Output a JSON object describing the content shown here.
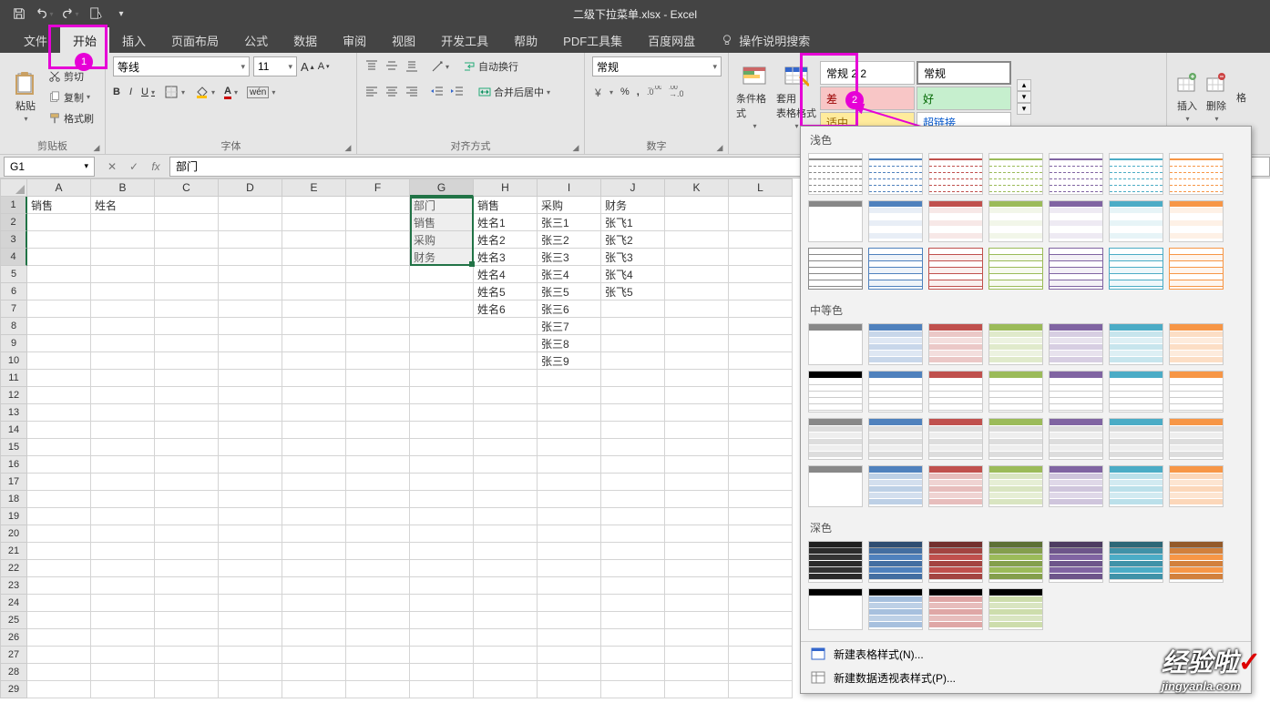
{
  "window": {
    "title": "二级下拉菜单.xlsx  -  Excel"
  },
  "qat": {
    "save": "保存",
    "undo": "撤销",
    "redo": "重做",
    "touch": "触摸"
  },
  "tabs": {
    "file": "文件",
    "home": "开始",
    "insert": "插入",
    "layout": "页面布局",
    "formulas": "公式",
    "data": "数据",
    "review": "审阅",
    "view": "视图",
    "dev": "开发工具",
    "help": "帮助",
    "pdf": "PDF工具集",
    "baidu": "百度网盘",
    "tellme": "操作说明搜索"
  },
  "steps": {
    "one": "1",
    "two": "2"
  },
  "clipboard": {
    "group": "剪贴板",
    "paste": "粘贴",
    "cut": "剪切",
    "copy": "复制",
    "painter": "格式刷"
  },
  "font": {
    "group": "字体",
    "name": "等线",
    "size": "11"
  },
  "align": {
    "group": "对齐方式",
    "wrap": "自动换行",
    "merge": "合并后居中"
  },
  "number": {
    "group": "数字",
    "format": "常规"
  },
  "styles": {
    "cond": "条件格式",
    "table": "套用\n表格格式",
    "s1": "常规 2 2",
    "s2": "常规",
    "s3": "差",
    "s4": "好",
    "s5": "适中",
    "s6": "超链接"
  },
  "cells_group": {
    "insert": "插入",
    "delete": "删除",
    "format": "格"
  },
  "fx": {
    "name_box": "G1",
    "cancel": "✕",
    "enter": "✓",
    "fx": "fx",
    "value": "部门"
  },
  "gallery": {
    "light": "浅色",
    "medium": "中等色",
    "dark": "深色",
    "new_style": "新建表格样式(N)...",
    "new_pivot": "新建数据透视表样式(P)..."
  },
  "columns": [
    "A",
    "B",
    "C",
    "D",
    "E",
    "F",
    "G",
    "H",
    "I",
    "J",
    "K",
    "L"
  ],
  "grid": {
    "rows": 29,
    "data": {
      "1": {
        "A": "销售",
        "B": "姓名",
        "G": "部门",
        "H": "销售",
        "I": "采购",
        "J": "财务"
      },
      "2": {
        "G": "销售",
        "H": "姓名1",
        "I": "张三1",
        "J": "张飞1"
      },
      "3": {
        "G": "采购",
        "H": "姓名2",
        "I": "张三2",
        "J": "张飞2"
      },
      "4": {
        "G": "财务",
        "H": "姓名3",
        "I": "张三3",
        "J": "张飞3"
      },
      "5": {
        "H": "姓名4",
        "I": "张三4",
        "J": "张飞4"
      },
      "6": {
        "H": "姓名5",
        "I": "张三5",
        "J": "张飞5"
      },
      "7": {
        "H": "姓名6",
        "I": "张三6"
      },
      "8": {
        "I": "张三7"
      },
      "9": {
        "I": "张三8"
      },
      "10": {
        "I": "张三9"
      }
    }
  },
  "watermark": {
    "zh": "经验啦",
    "url": "jingyanla.com"
  }
}
